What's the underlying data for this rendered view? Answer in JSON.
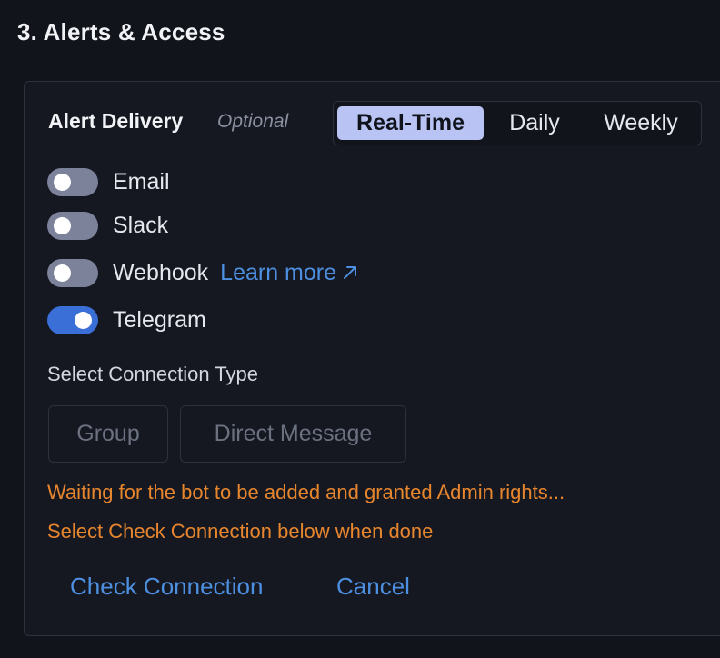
{
  "section": {
    "title": "3. Alerts & Access"
  },
  "delivery": {
    "label": "Alert Delivery",
    "optional": "Optional",
    "frequency": {
      "options": [
        "Real-Time",
        "Daily",
        "Weekly"
      ],
      "selected": "Real-Time"
    }
  },
  "channels": [
    {
      "label": "Email",
      "enabled": false
    },
    {
      "label": "Slack",
      "enabled": false
    },
    {
      "label": "Webhook",
      "enabled": false,
      "link": "Learn more"
    },
    {
      "label": "Telegram",
      "enabled": true
    }
  ],
  "connection": {
    "label": "Select Connection Type",
    "options": [
      "Group",
      "Direct Message"
    ]
  },
  "status": {
    "waiting": "Waiting for the bot to be added and granted Admin rights...",
    "instruction": "Select Check Connection below when done"
  },
  "actions": {
    "check": "Check Connection",
    "cancel": "Cancel"
  },
  "colors": {
    "accent": "#3a6fd8",
    "link": "#4d8fe0",
    "warning": "#e8862e",
    "segment_active": "#b9c4f4"
  },
  "icons": {
    "learn_more": "external-link-arrow-icon"
  }
}
